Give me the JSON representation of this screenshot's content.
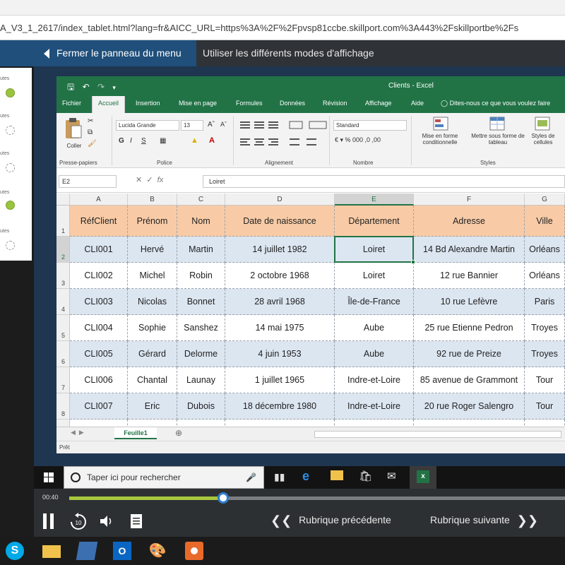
{
  "browser": {
    "url": "A_V3_1_2617/index_tablet.html?lang=fr&AICC_URL=https%3A%2F%2Fpvsp81ccbe.skillport.com%3A443%2Fskillportbe%2Fs"
  },
  "course": {
    "close_menu_label": "Fermer le panneau du menu",
    "topic_title": "Utiliser les différents modes d'affichage",
    "side_items": [
      {
        "label": "utes",
        "status": "done"
      },
      {
        "label": "utes",
        "status": "todo"
      },
      {
        "label": "utes",
        "status": "todo"
      },
      {
        "label": "utes",
        "status": "done"
      },
      {
        "label": "utes",
        "status": "todo"
      }
    ]
  },
  "excel": {
    "window_title": "Clients - Excel",
    "tabs": [
      "Fichier",
      "Accueil",
      "Insertion",
      "Mise en page",
      "Formules",
      "Données",
      "Révision",
      "Affichage",
      "Aide"
    ],
    "active_tab": "Accueil",
    "tell_me": "Dites-nous ce que vous voulez faire",
    "ribbon": {
      "paste_label": "Coller",
      "font_name": "Lucida Grande",
      "font_size": "13",
      "number_format": "Standard",
      "conditional_format": "Mise en forme conditionnelle",
      "format_as_table": "Mettre sous forme de tableau",
      "cell_styles": "Styles de cellules",
      "groups": [
        "Presse-papiers",
        "Police",
        "Alignement",
        "Nombre",
        "Styles"
      ],
      "bold": "G",
      "italic": "I",
      "underline": "S"
    },
    "name_box": "E2",
    "formula_value": "Loiret",
    "columns": [
      "A",
      "B",
      "C",
      "D",
      "E",
      "F",
      "G"
    ],
    "rows": [
      "1",
      "2",
      "3",
      "4",
      "5",
      "6",
      "7",
      "8"
    ],
    "selected_column": "E",
    "selected_row": "2",
    "table": {
      "headers": [
        "RéfClient",
        "Prénom",
        "Nom",
        "Date de naissance",
        "Département",
        "Adresse",
        "Ville"
      ],
      "data": [
        [
          "CLI001",
          "Hervé",
          "Martin",
          "14 juillet 1982",
          "Loiret",
          "14 Bd Alexandre Martin",
          "Orléans"
        ],
        [
          "CLI002",
          "Michel",
          "Robin",
          "2 octobre 1968",
          "Loiret",
          "12 rue Bannier",
          "Orléans"
        ],
        [
          "CLI003",
          "Nicolas",
          "Bonnet",
          "28 avril 1968",
          "Île-de-France",
          "10 rue Lefèvre",
          "Paris"
        ],
        [
          "CLI004",
          "Sophie",
          "Sanshez",
          "14 mai 1975",
          "Aube",
          "25 rue Etienne Pedron",
          "Troyes"
        ],
        [
          "CLI005",
          "Gérard",
          "Delorme",
          "4 juin 1953",
          "Aube",
          "92 rue de Preize",
          "Troyes"
        ],
        [
          "CLI006",
          "Chantal",
          "Launay",
          "1 juillet 1965",
          "Indre-et-Loire",
          "85 avenue de Grammont",
          "Tour"
        ],
        [
          "CLI007",
          "Eric",
          "Dubois",
          "18 décembre 1980",
          "Indre-et-Loire",
          "20 rue Roger Salengro",
          "Tour"
        ]
      ]
    },
    "sheet_tab": "Feuille1",
    "status": "Prêt"
  },
  "taskbar": {
    "search_placeholder": "Taper ici pour rechercher"
  },
  "player": {
    "time": "00:40",
    "progress": 0.31,
    "prev_label": "Rubrique précédente",
    "next_label": "Rubrique suivante"
  },
  "colors": {
    "excel_green": "#217346",
    "header_fill": "#f8cba6",
    "row_alt": "#dce6f1",
    "progress": "#a8c73e",
    "menu_blue": "#1f4f7a"
  }
}
